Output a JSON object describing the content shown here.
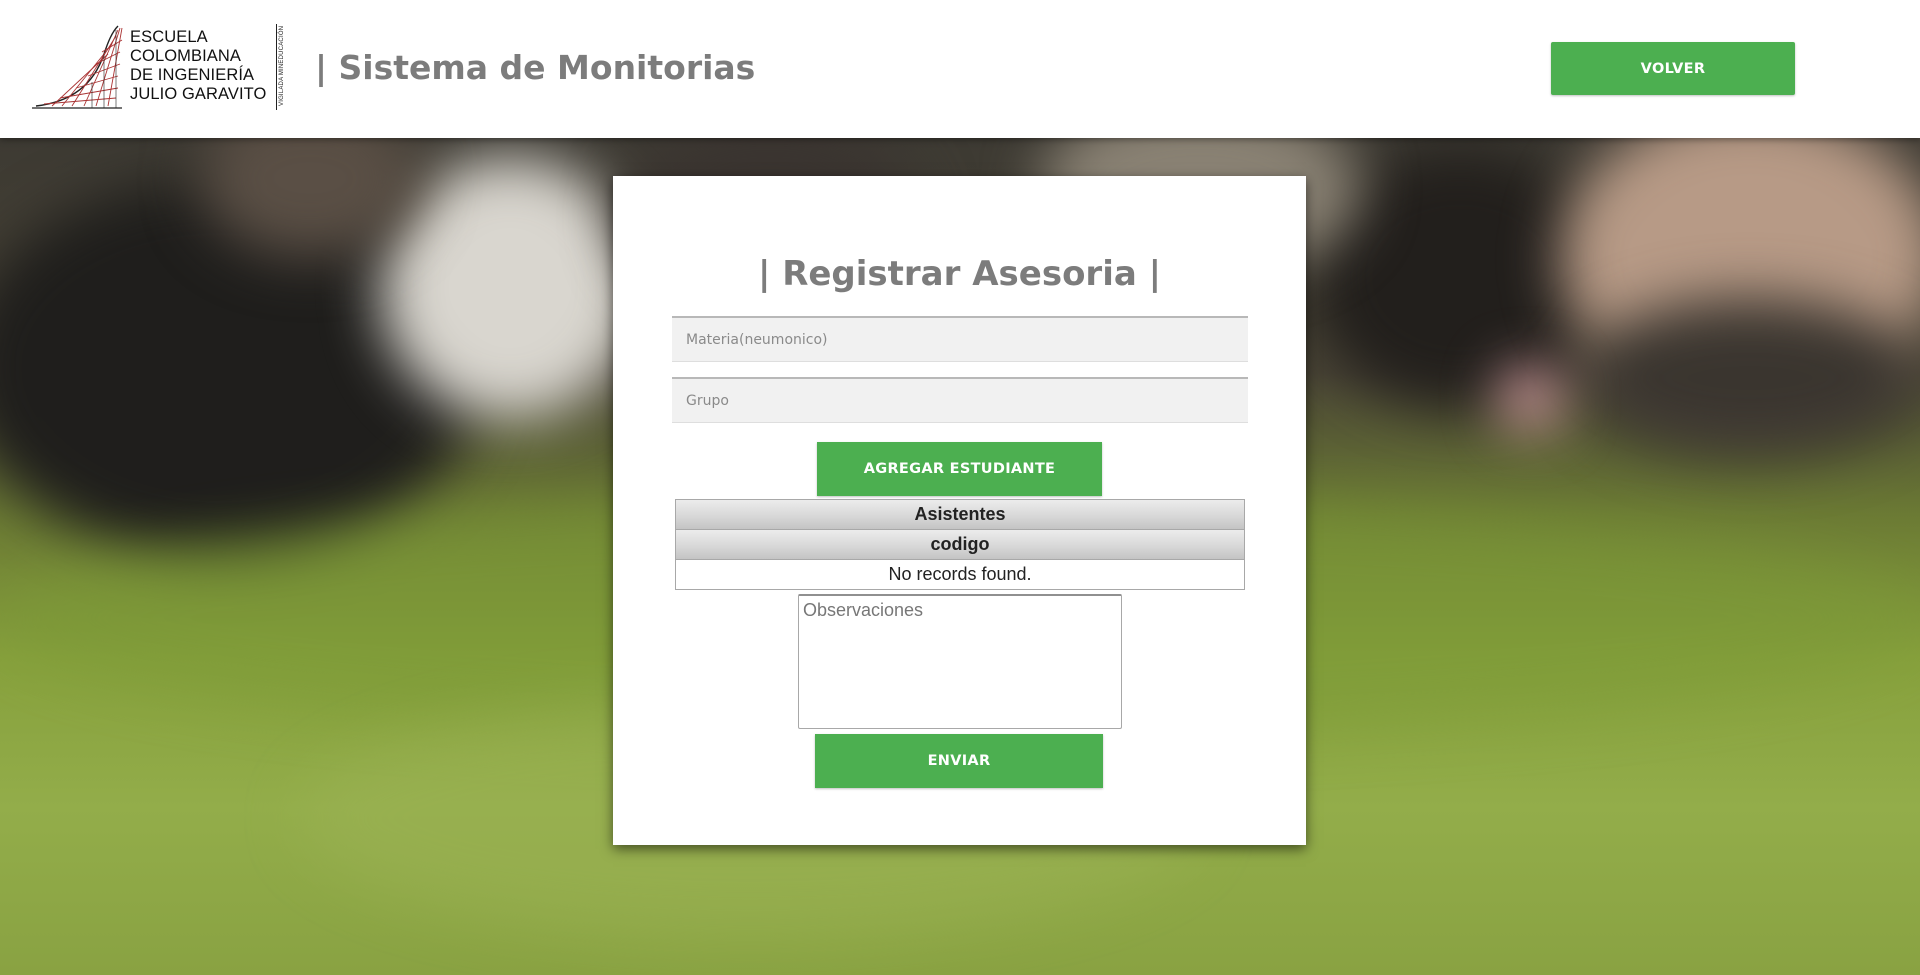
{
  "header": {
    "logo_lines": [
      "ESCUELA",
      "COLOMBIANA",
      "DE INGENIERÍA",
      "JULIO GARAVITO"
    ],
    "logo_vertical_text": "VIGILADA MINEDUCACIÓN",
    "site_title": "| Sistema de Monitorias",
    "back_button": "VOLVER"
  },
  "form": {
    "title": "| Registrar Asesoria |",
    "materia_placeholder": "Materia(neumonico)",
    "materia_value": "",
    "grupo_placeholder": "Grupo",
    "grupo_value": "",
    "add_student_button": "AGREGAR ESTUDIANTE",
    "table": {
      "caption": "Asistentes",
      "columns": [
        "codigo"
      ],
      "empty_message": "No records found."
    },
    "observaciones_placeholder": "Observaciones",
    "submit_button": "ENVIAR"
  },
  "colors": {
    "accent_green": "#4caf50",
    "title_gray": "#7c7c7c"
  }
}
